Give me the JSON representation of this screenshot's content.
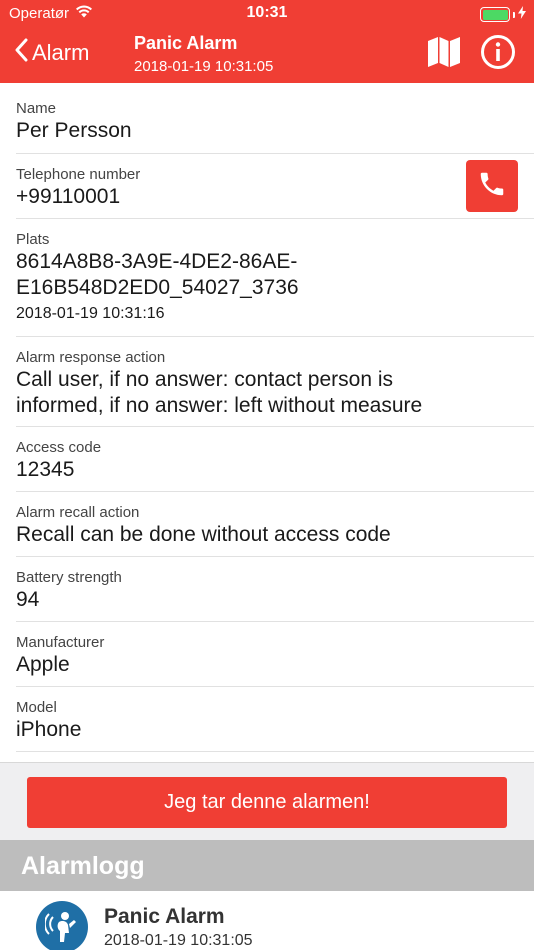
{
  "status": {
    "carrier": "Operatør",
    "time": "10:31"
  },
  "nav": {
    "back_label": "Alarm",
    "title": "Panic Alarm",
    "subtitle": "2018-01-19 10:31:05"
  },
  "fields": [
    {
      "label": "Name",
      "value": "Per Persson"
    },
    {
      "label": "Telephone number",
      "value": "+99110001"
    },
    {
      "label": "Plats",
      "value_lines": [
        "8614A8B8-3A9E-4DE2-86AE-",
        "E16B548D2ED0_54027_3736"
      ],
      "sub": "2018-01-19 10:31:16"
    },
    {
      "label": "Alarm response action",
      "value_lines": [
        "Call user, if no answer: contact person is",
        "informed, if no answer: left without measure"
      ]
    },
    {
      "label": "Access code",
      "value": "12345"
    },
    {
      "label": "Alarm recall action",
      "value": "Recall can be done without access code"
    },
    {
      "label": "Battery strength",
      "value": "94"
    },
    {
      "label": "Manufacturer",
      "value": "Apple"
    },
    {
      "label": "Model",
      "value": "iPhone"
    }
  ],
  "take_alarm_label": "Jeg tar denne alarmen!",
  "alarm_log": {
    "header": "Alarmlogg",
    "items": [
      {
        "title": "Panic Alarm",
        "time": "2018-01-19 10:31:05",
        "icon": "panic-person-icon"
      }
    ]
  },
  "colors": {
    "accent": "#f03e34",
    "battery": "#4cd964",
    "log_header": "#bdbdbd",
    "avatar": "#1f6fa6"
  }
}
